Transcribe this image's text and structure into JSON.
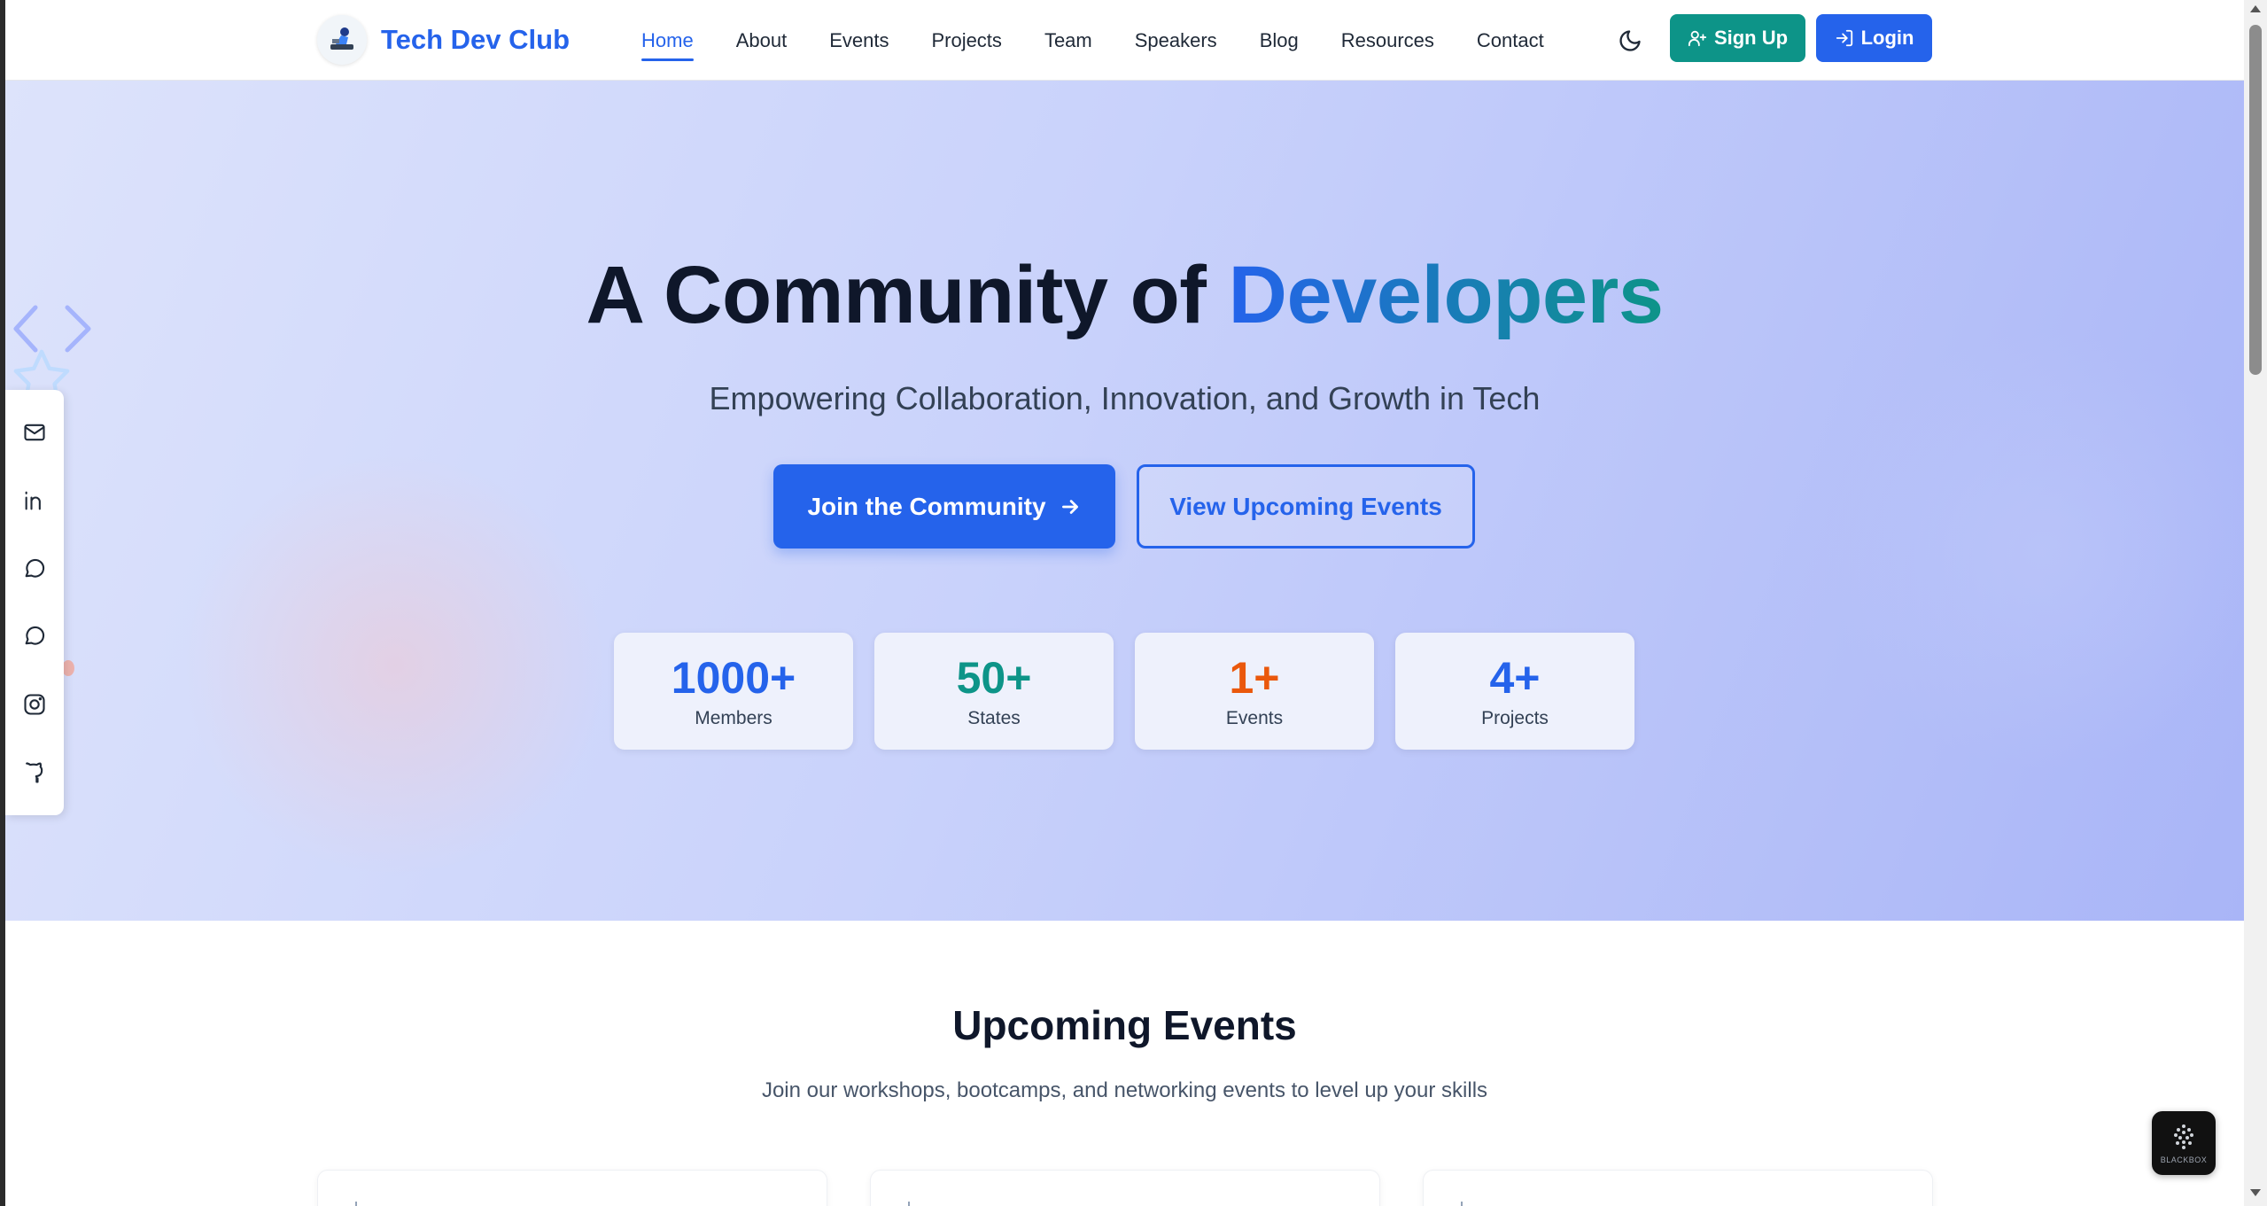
{
  "brand": {
    "name": "Tech Dev Club",
    "logo_icon": "club-mascot-logo"
  },
  "nav": {
    "items": [
      {
        "label": "Home",
        "active": true
      },
      {
        "label": "About"
      },
      {
        "label": "Events"
      },
      {
        "label": "Projects"
      },
      {
        "label": "Team"
      },
      {
        "label": "Speakers"
      },
      {
        "label": "Blog"
      },
      {
        "label": "Resources"
      },
      {
        "label": "Contact"
      }
    ],
    "theme_toggle_icon": "moon-icon",
    "signup_label": "Sign Up",
    "login_label": "Login"
  },
  "hero": {
    "title_prefix": "A Community of ",
    "title_accent": "Developers",
    "subtitle": "Empowering Collaboration, Innovation, and Growth in Tech",
    "primary_cta": "Join the Community",
    "secondary_cta": "View Upcoming Events",
    "stats": [
      {
        "value": "1000+",
        "label": "Members",
        "color": "#2563eb"
      },
      {
        "value": "50+",
        "label": "States",
        "color": "#0d9488"
      },
      {
        "value": "1+",
        "label": "Events",
        "color": "#ea580c"
      },
      {
        "value": "4+",
        "label": "Projects",
        "color": "#2563eb"
      }
    ]
  },
  "social": [
    "mail-icon",
    "linkedin-icon",
    "chat-icon",
    "message-icon",
    "instagram-icon",
    "github-icon"
  ],
  "events_section": {
    "title": "Upcoming Events",
    "subtitle": "Join our workshops, bootcamps, and networking events to level up your skills"
  },
  "widget": {
    "label": "BLACKBOX"
  },
  "colors": {
    "primary": "#2563eb",
    "teal": "#0d9488",
    "orange": "#ea580c",
    "text": "#0f172a"
  }
}
